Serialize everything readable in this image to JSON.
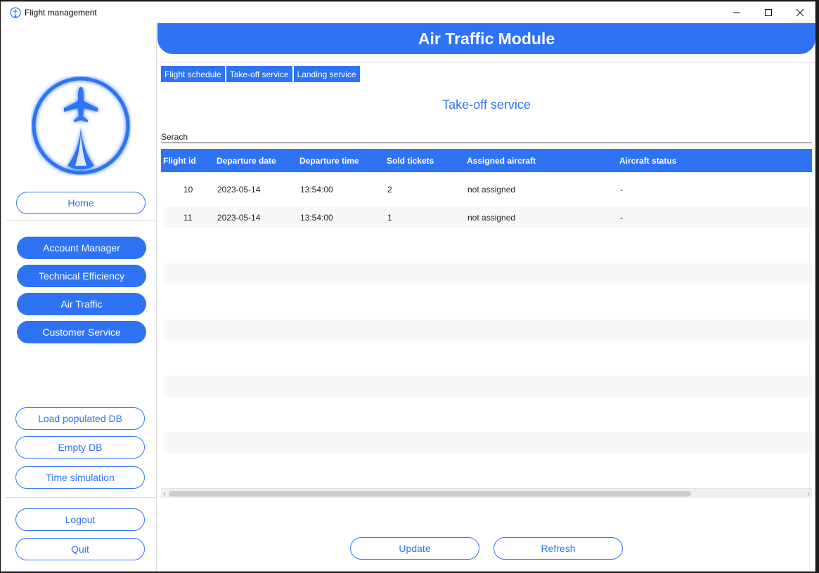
{
  "window": {
    "title": "Flight management"
  },
  "header": {
    "title": "Air Traffic Module"
  },
  "sidebar": {
    "home": "Home",
    "nav": [
      "Account Manager",
      "Technical Efficiency",
      "Air Traffic",
      "Customer Service"
    ],
    "db": [
      "Load populated DB",
      "Empty DB",
      "Time simulation"
    ],
    "session": [
      "Logout",
      "Quit"
    ]
  },
  "tabs": [
    "Flight schedule",
    "Take-off service",
    "Landing service"
  ],
  "section": {
    "title": "Take-off service"
  },
  "search": {
    "placeholder": "Serach"
  },
  "table": {
    "columns": [
      "Flight id",
      "Departure date",
      "Departure time",
      "Sold tickets",
      "Assigned aircraft",
      "Aircraft status"
    ],
    "rows": [
      [
        "10",
        "2023-05-14",
        "13:54:00",
        "2",
        "not assigned",
        "-"
      ],
      [
        "11",
        "2023-05-14",
        "13:54:00",
        "1",
        "not assigned",
        "-"
      ]
    ]
  },
  "actions": {
    "update": "Update",
    "refresh": "Refresh"
  },
  "colors": {
    "accent": "#2f73f5",
    "row_alt": "#f7f7f7"
  }
}
